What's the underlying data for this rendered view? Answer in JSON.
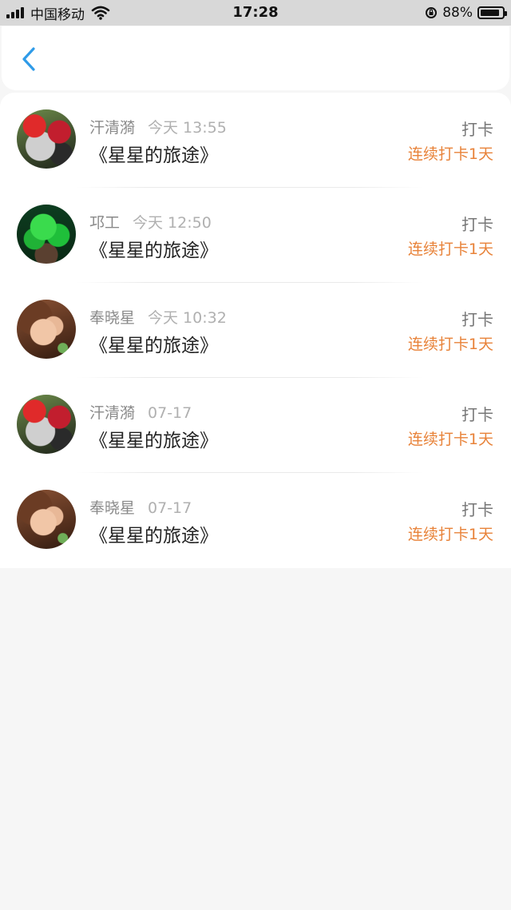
{
  "status_bar": {
    "carrier": "中国移动",
    "time": "17:28",
    "battery_percent": "88%",
    "battery_level": 0.88,
    "icons": [
      "signal-icon",
      "wifi-icon",
      "orientation-lock-icon",
      "battery-icon"
    ]
  },
  "nav": {
    "back_icon": "chevron-left-icon",
    "accent_color": "#2f9be8"
  },
  "colors": {
    "streak": "#e8833a",
    "background": "#f6f6f6"
  },
  "records": [
    {
      "name": "汗清漪",
      "time": "今天 13:55",
      "title": "《星星的旅途》",
      "action": "打卡",
      "streak": "连续打卡1天",
      "avatar": "red-flowers-avatar"
    },
    {
      "name": "邛工",
      "time": "今天 12:50",
      "title": "《星星的旅途》",
      "action": "打卡",
      "streak": "连续打卡1天",
      "avatar": "jade-avatar"
    },
    {
      "name": "奉晓星",
      "time": "今天 10:32",
      "title": "《星星的旅途》",
      "action": "打卡",
      "streak": "连续打卡1天",
      "avatar": "girl-avatar"
    },
    {
      "name": "汗清漪",
      "time": "07-17",
      "title": "《星星的旅途》",
      "action": "打卡",
      "streak": "连续打卡1天",
      "avatar": "red-flowers-avatar"
    },
    {
      "name": "奉晓星",
      "time": "07-17",
      "title": "《星星的旅途》",
      "action": "打卡",
      "streak": "连续打卡1天",
      "avatar": "girl-avatar"
    }
  ]
}
